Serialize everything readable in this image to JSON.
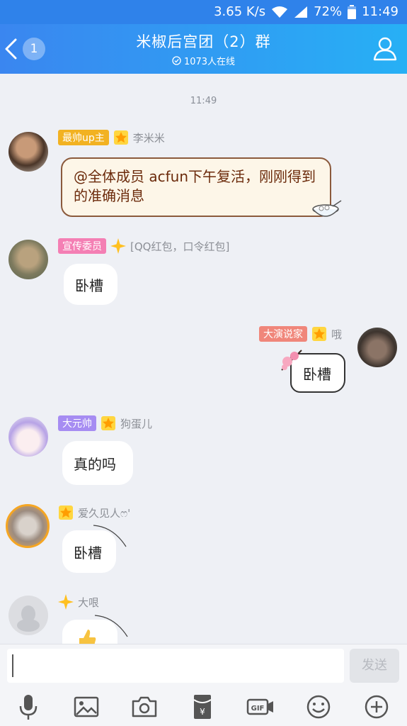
{
  "status": {
    "speed": "3.65 K/s",
    "battery": "72%",
    "time": "11:49"
  },
  "header": {
    "back_count": "1",
    "title": "米椒后宫团（2）群",
    "online": "1073人在线"
  },
  "chat": {
    "timestamp": "11:49",
    "messages": [
      {
        "tag": "最帅up主",
        "tag_color": "#f2b222",
        "name": "李米米",
        "text": "@全体成员 acfun下午复活，刚刚得到的准确消息"
      },
      {
        "tag": "宣传委员",
        "tag_color": "#f47fb4",
        "name": "[QQ红包，口令红包]",
        "text": "卧槽"
      },
      {
        "tag": "大演说家",
        "tag_color": "#f0867a",
        "name": "哦",
        "text": "卧槽"
      },
      {
        "tag": "大元帅",
        "tag_color": "#a68cf2",
        "name": "狗蛋儿",
        "text": "真的吗"
      },
      {
        "name": "爱久见人ෆ'",
        "text": "卧槽"
      },
      {
        "name": "大哏"
      }
    ]
  },
  "input": {
    "placeholder": "",
    "send_label": "发送"
  },
  "icons": [
    "mic-icon",
    "image-icon",
    "camera-icon",
    "red-packet-icon",
    "gif-icon",
    "emoji-icon",
    "plus-icon"
  ]
}
